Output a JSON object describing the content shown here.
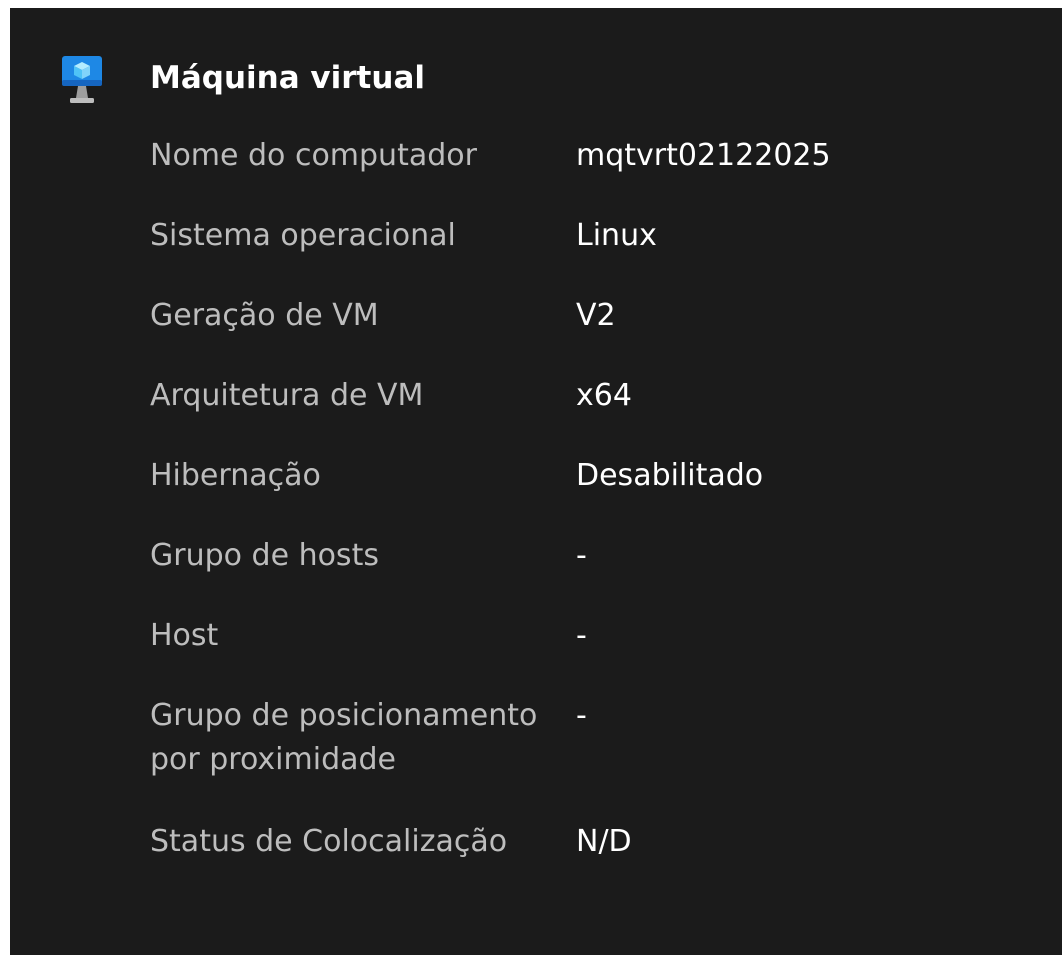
{
  "section": {
    "title": "Máquina virtual",
    "icon": "virtual-machine-icon"
  },
  "colors": {
    "background": "#1b1b1b",
    "label": "#bdbdbd",
    "value": "#ffffff",
    "icon_blue": "#1e88e5",
    "icon_cube": "#7fd3f7"
  },
  "rows": [
    {
      "label": "Nome do computador",
      "value": "mqtvrt02122025"
    },
    {
      "label": "Sistema operacional",
      "value": "Linux"
    },
    {
      "label": "Geração de VM",
      "value": "V2"
    },
    {
      "label": "Arquitetura de VM",
      "value": "x64"
    },
    {
      "label": "Hibernação",
      "value": "Desabilitado"
    },
    {
      "label": "Grupo de hosts",
      "value": "-"
    },
    {
      "label": "Host",
      "value": "-"
    },
    {
      "label": "Grupo de posicionamento por proximidade",
      "value": "-"
    },
    {
      "label": "Status de Colocalização",
      "value": "N/D"
    }
  ]
}
